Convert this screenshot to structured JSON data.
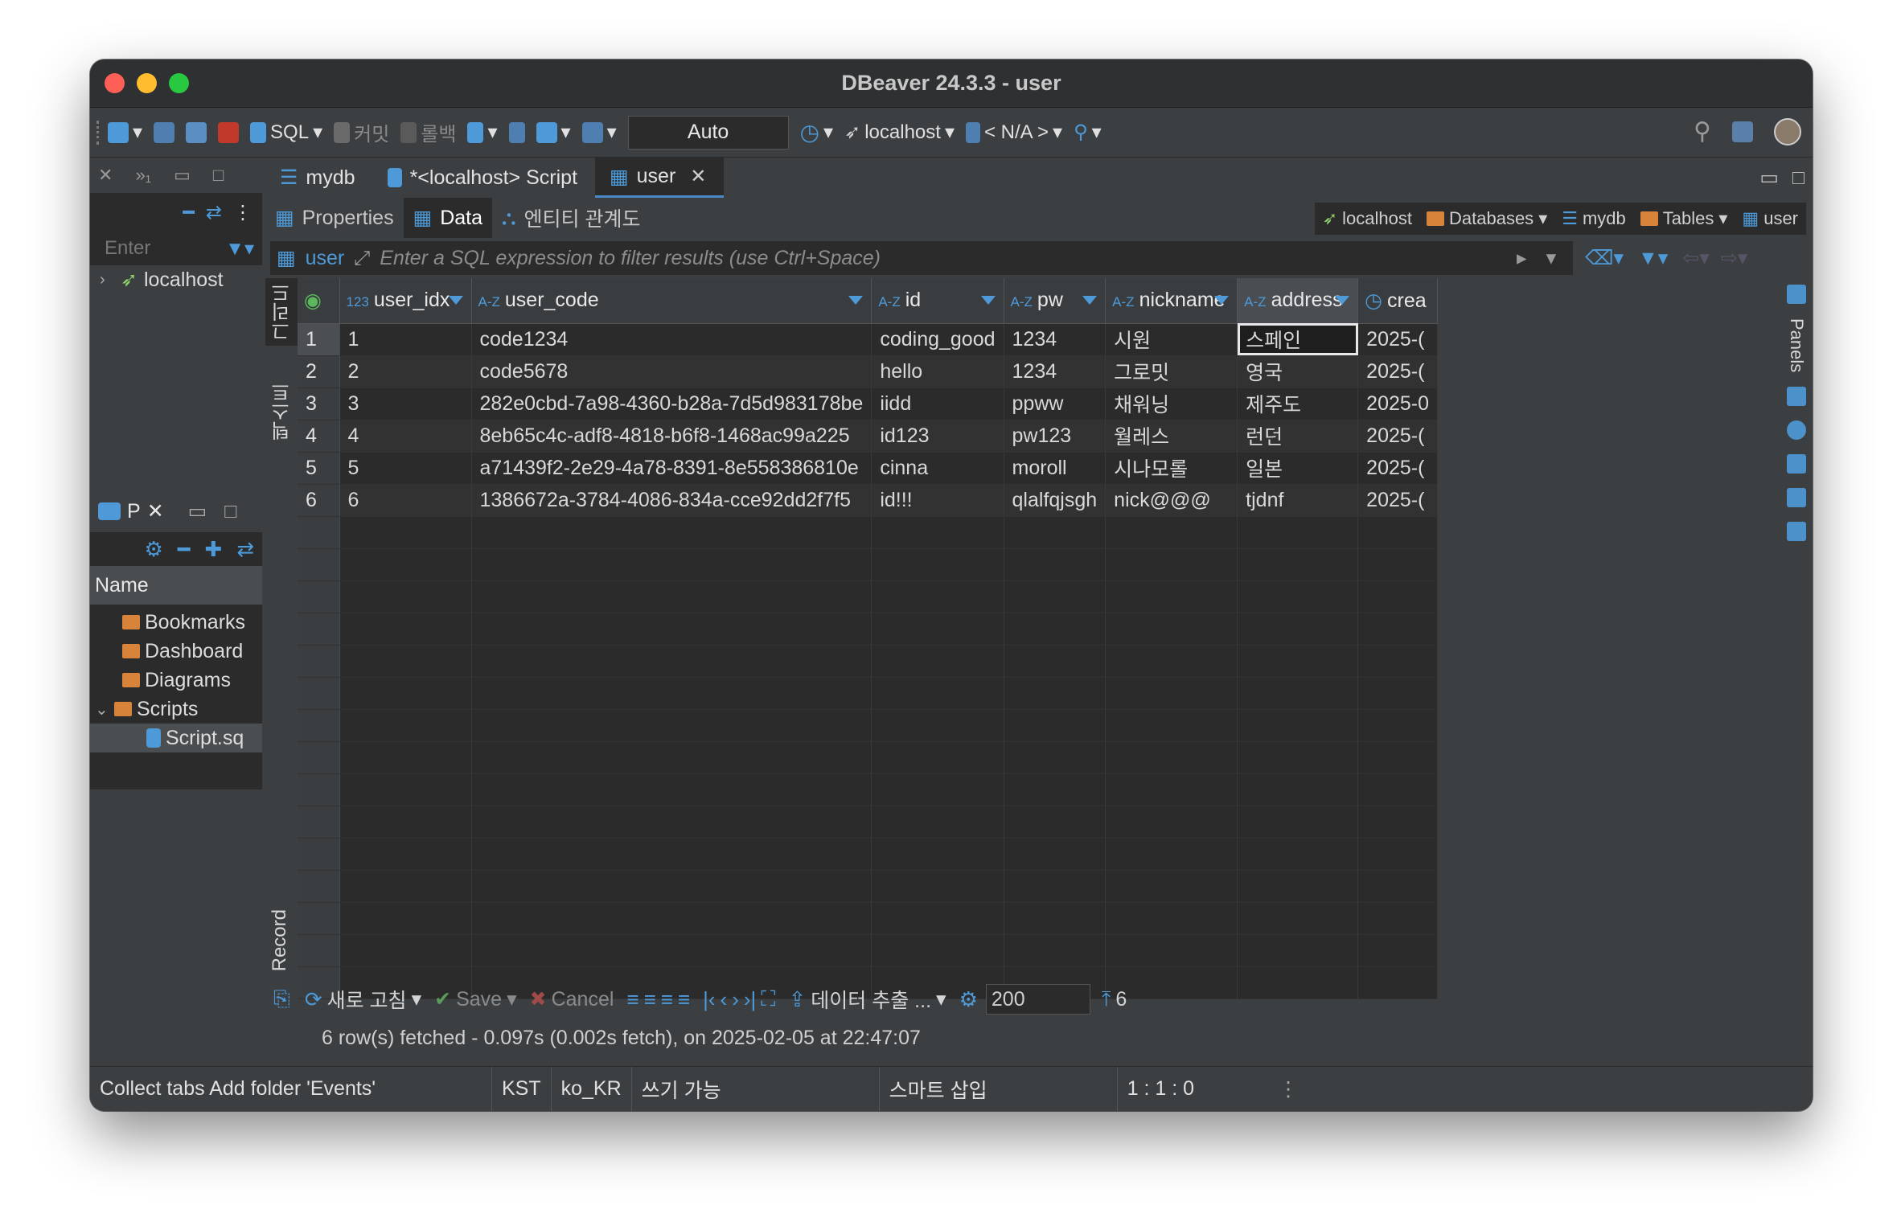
{
  "window": {
    "title": "DBeaver 24.3.3 - user"
  },
  "toolbar": {
    "sql": "SQL",
    "commit": "커밋",
    "rollback": "롤백",
    "transaction_mode": "Auto",
    "connection": "localhost",
    "schema": "< N/A >"
  },
  "navigator": {
    "filter_placeholder": "Enter",
    "tree": [
      {
        "label": "localhost"
      }
    ]
  },
  "projects": {
    "tab": "P",
    "column_header": "Name",
    "items": [
      {
        "label": "Bookmarks"
      },
      {
        "label": "Dashboard"
      },
      {
        "label": "Diagrams"
      },
      {
        "label": "Scripts"
      },
      {
        "label": "Script.sq"
      }
    ]
  },
  "editor_tabs": [
    {
      "label": "mydb"
    },
    {
      "label": "*<localhost> Script"
    },
    {
      "label": "user"
    }
  ],
  "sub_tabs": [
    {
      "label": "Properties"
    },
    {
      "label": "Data"
    },
    {
      "label": "엔티티 관계도"
    }
  ],
  "breadcrumbs": [
    "localhost",
    "Databases",
    "mydb",
    "Tables",
    "user"
  ],
  "filter": {
    "table_label": "user",
    "placeholder": "Enter a SQL expression to filter results (use Ctrl+Space)"
  },
  "view_tabs": {
    "grid": "그리드",
    "text": "텍스트",
    "record": "Record"
  },
  "grid": {
    "columns": [
      {
        "type": "123",
        "name": "user_idx"
      },
      {
        "type": "A-Z",
        "name": "user_code"
      },
      {
        "type": "A-Z",
        "name": "id"
      },
      {
        "type": "A-Z",
        "name": "pw"
      },
      {
        "type": "A-Z",
        "name": "nickname"
      },
      {
        "type": "A-Z",
        "name": "address"
      },
      {
        "type": "",
        "name": "crea"
      }
    ],
    "rows": [
      [
        "1",
        "code1234",
        "coding_good",
        "1234",
        "시원",
        "스페인",
        "2025-("
      ],
      [
        "2",
        "code5678",
        "hello",
        "1234",
        "그로밋",
        "영국",
        "2025-("
      ],
      [
        "3",
        "282e0cbd-7a98-4360-b28a-7d5d983178be",
        "iidd",
        "ppww",
        "채워닝",
        "제주도",
        "2025-0"
      ],
      [
        "4",
        "8eb65c4c-adf8-4818-b6f8-1468ac99a225",
        "id123",
        "pw123",
        "월레스",
        "런던",
        "2025-("
      ],
      [
        "5",
        "a71439f2-2e29-4a78-8391-8e558386810e",
        "cinna",
        "moroll",
        "시나모롤",
        "일본",
        "2025-("
      ],
      [
        "6",
        "1386672a-3784-4086-834a-cce92dd2f7f5",
        "id!!!",
        "qlalfqjsgh",
        "nick@@@",
        "tjdnf",
        "2025-("
      ]
    ],
    "row_numbers": [
      "1",
      "2",
      "3",
      "4",
      "5",
      "6"
    ]
  },
  "panels_label": "Panels",
  "bottom": {
    "refresh": "새로 고침",
    "save": "Save",
    "cancel": "Cancel",
    "export": "데이터 추출 ...",
    "fetch_size": "200",
    "row_count": "6",
    "fetch_status": "6 row(s) fetched - 0.097s (0.002s fetch), on 2025-02-05 at 22:47:07"
  },
  "status": {
    "message": "Collect tabs Add folder 'Events'",
    "timezone": "KST",
    "locale": "ko_KR",
    "mode": "쓰기 가능",
    "insert": "스마트 삽입",
    "position": "1 : 1 : 0"
  },
  "colors": {
    "accent": "#4e9ad8",
    "background": "#2b2b2b",
    "panel": "#3c3f41"
  }
}
